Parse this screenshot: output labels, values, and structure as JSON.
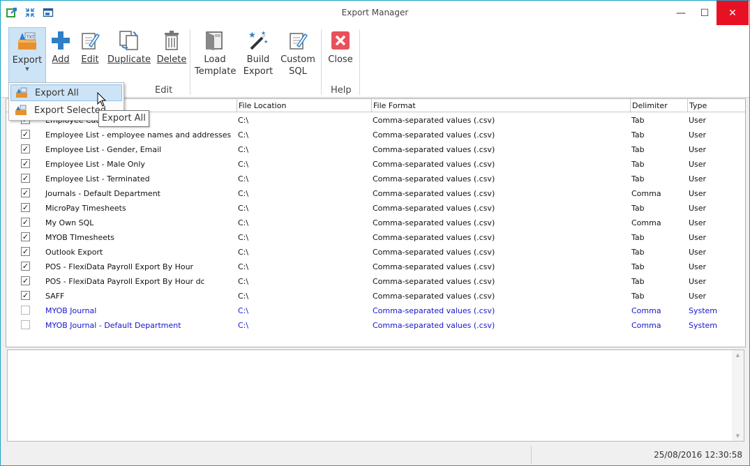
{
  "window": {
    "title": "Export Manager",
    "minimize": "—",
    "maximize": "☐",
    "close": "✕"
  },
  "ribbon": {
    "buttons": [
      {
        "label": "Export",
        "icon": "export-icon"
      },
      {
        "label": "Add",
        "icon": "add-icon"
      },
      {
        "label": "Edit",
        "icon": "edit-icon"
      },
      {
        "label": "Duplicate",
        "icon": "duplicate-icon"
      },
      {
        "label": "Delete",
        "icon": "delete-icon"
      },
      {
        "label": "Load\nTemplate",
        "icon": "load-template-icon"
      },
      {
        "label": "Build\nExport",
        "icon": "build-export-icon"
      },
      {
        "label": "Custom\nSQL",
        "icon": "custom-sql-icon"
      },
      {
        "label": "Close",
        "icon": "close-red-icon"
      }
    ],
    "groups": {
      "edit": "Edit",
      "help": "Help"
    },
    "colors": {
      "accent_blue": "#2f7fc8",
      "close_red": "#e8505b",
      "selected": "#cde4f7"
    }
  },
  "dropdown": {
    "items": [
      "Export All",
      "Export Selected"
    ],
    "tooltip": "Export All"
  },
  "grid": {
    "columns": [
      "File Location",
      "File Format",
      "Delimiter",
      "Type"
    ],
    "rows": [
      {
        "checked": true,
        "name": "Employee Categ",
        "loc": "C:\\",
        "fmt": "Comma-separated values (.csv)",
        "delim": "Tab",
        "type": "User",
        "system": false
      },
      {
        "checked": true,
        "name": "Employee List - employee names and addresses",
        "loc": "C:\\",
        "fmt": "Comma-separated values (.csv)",
        "delim": "Tab",
        "type": "User",
        "system": false
      },
      {
        "checked": true,
        "name": "Employee List - Gender, Email",
        "loc": "C:\\",
        "fmt": "Comma-separated values (.csv)",
        "delim": "Tab",
        "type": "User",
        "system": false
      },
      {
        "checked": true,
        "name": "Employee List - Male Only",
        "loc": "C:\\",
        "fmt": "Comma-separated values (.csv)",
        "delim": "Tab",
        "type": "User",
        "system": false
      },
      {
        "checked": true,
        "name": "Employee List - Terminated",
        "loc": "C:\\",
        "fmt": "Comma-separated values (.csv)",
        "delim": "Tab",
        "type": "User",
        "system": false
      },
      {
        "checked": true,
        "name": "Journals - Default Department",
        "loc": "C:\\",
        "fmt": "Comma-separated values (.csv)",
        "delim": "Comma",
        "type": "User",
        "system": false
      },
      {
        "checked": true,
        "name": "MicroPay Timesheets",
        "loc": "C:\\",
        "fmt": "Comma-separated values (.csv)",
        "delim": "Tab",
        "type": "User",
        "system": false
      },
      {
        "checked": true,
        "name": "My Own SQL",
        "loc": "C:\\",
        "fmt": "Comma-separated values (.csv)",
        "delim": "Comma",
        "type": "User",
        "system": false
      },
      {
        "checked": true,
        "name": "MYOB TImesheets",
        "loc": "C:\\",
        "fmt": "Comma-separated values (.csv)",
        "delim": "Tab",
        "type": "User",
        "system": false
      },
      {
        "checked": true,
        "name": "Outlook Export",
        "loc": "C:\\",
        "fmt": "Comma-separated values (.csv)",
        "delim": "Tab",
        "type": "User",
        "system": false
      },
      {
        "checked": true,
        "name": "POS - FlexiData Payroll Export By Hour",
        "loc": "C:\\",
        "fmt": "Comma-separated values (.csv)",
        "delim": "Tab",
        "type": "User",
        "system": false
      },
      {
        "checked": true,
        "name": "POS - FlexiData Payroll Export By Hour dc",
        "loc": "C:\\",
        "fmt": "Comma-separated values (.csv)",
        "delim": "Tab",
        "type": "User",
        "system": false
      },
      {
        "checked": true,
        "name": "SAFF",
        "loc": "C:\\",
        "fmt": "Comma-separated values (.csv)",
        "delim": "Tab",
        "type": "User",
        "system": false
      },
      {
        "checked": false,
        "name": "MYOB Journal",
        "loc": "C:\\",
        "fmt": "Comma-separated values (.csv)",
        "delim": "Comma",
        "type": "System",
        "system": true
      },
      {
        "checked": false,
        "name": "MYOB Journal - Default Department",
        "loc": "C:\\",
        "fmt": "Comma-separated values (.csv)",
        "delim": "Comma",
        "type": "System",
        "system": true
      }
    ]
  },
  "status": {
    "datetime": "25/08/2016 12:30:58"
  }
}
